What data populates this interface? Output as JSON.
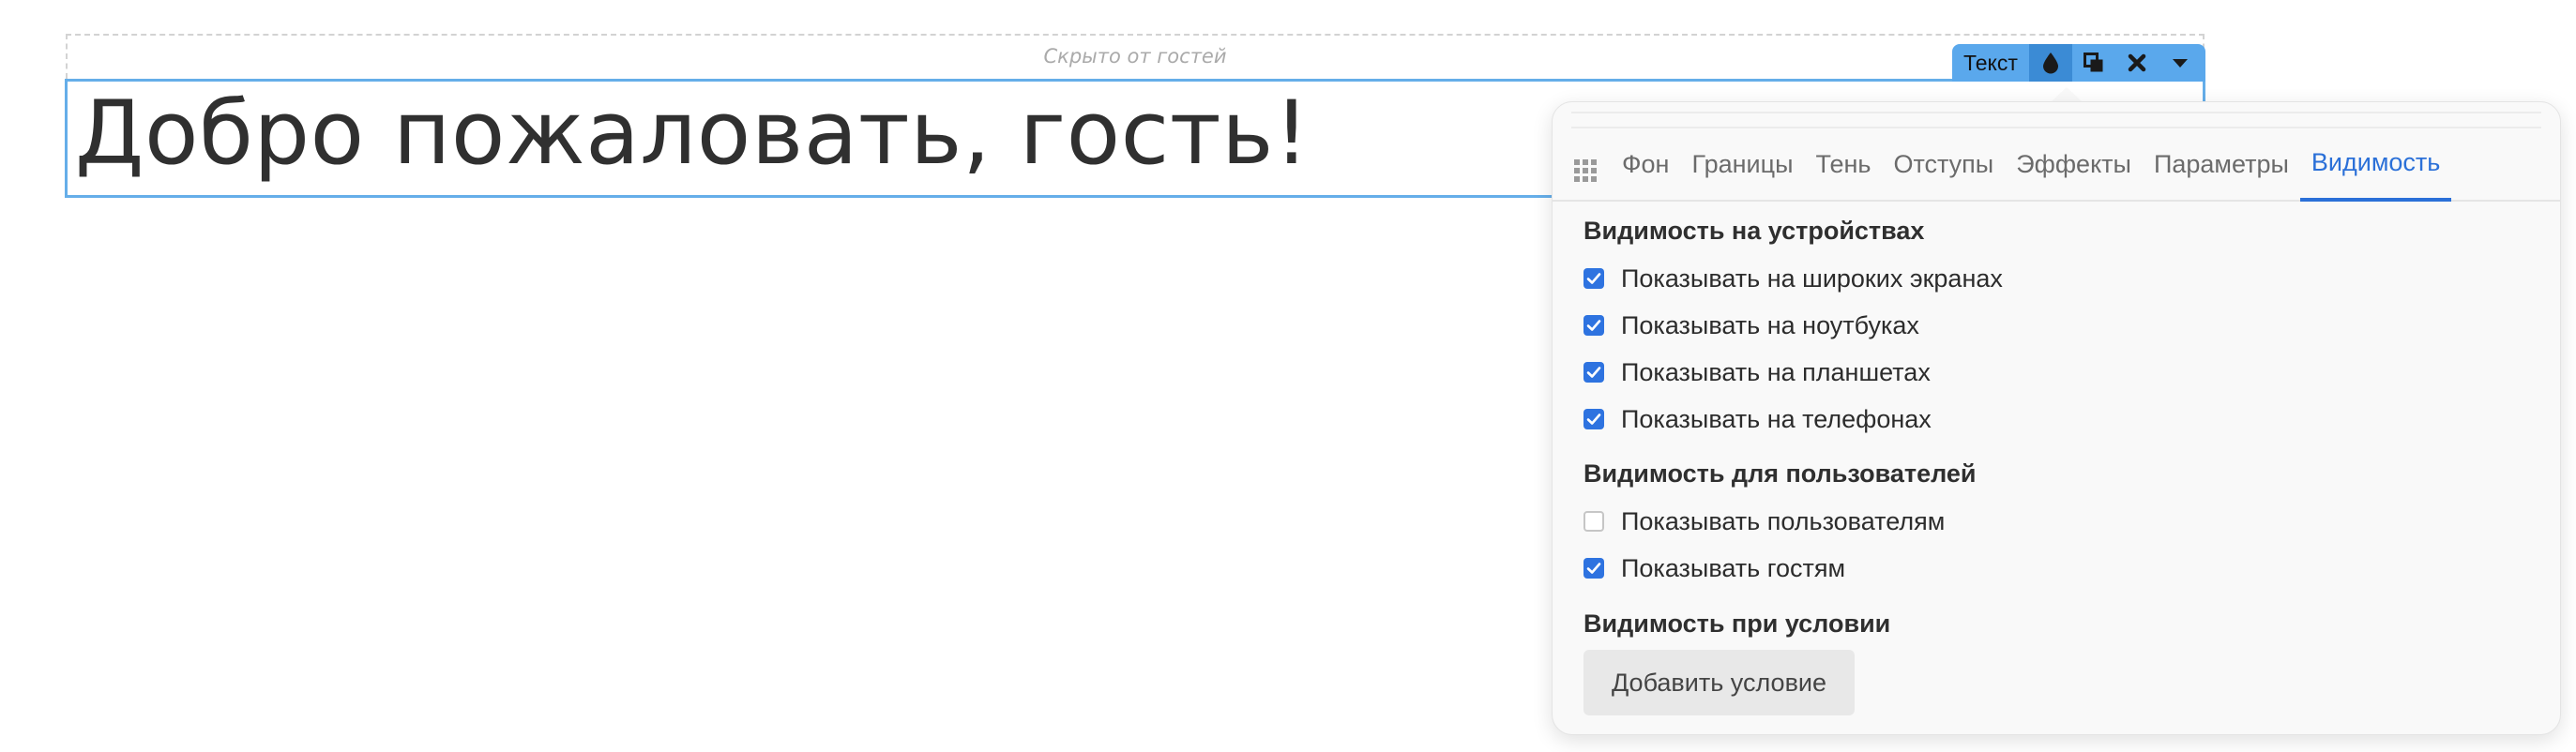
{
  "editor": {
    "hidden_note": "Скрыто от гостей",
    "greeting": "Добро пожаловать, гость!"
  },
  "toolbar": {
    "label": "Текст",
    "buttons": [
      "drop-icon",
      "duplicate-icon",
      "close-icon",
      "caret-down-icon"
    ]
  },
  "panel": {
    "tabs": [
      {
        "label": "Фон"
      },
      {
        "label": "Границы"
      },
      {
        "label": "Тень"
      },
      {
        "label": "Отступы"
      },
      {
        "label": "Эффекты"
      },
      {
        "label": "Параметры"
      },
      {
        "label": "Видимость",
        "active": true
      }
    ],
    "devices": {
      "title": "Видимость на устройствах",
      "options": [
        {
          "label": "Показывать на широких экранах",
          "checked": true
        },
        {
          "label": "Показывать на ноутбуках",
          "checked": true
        },
        {
          "label": "Показывать на планшетах",
          "checked": true
        },
        {
          "label": "Показывать на телефонах",
          "checked": true
        }
      ]
    },
    "users": {
      "title": "Видимость для пользователей",
      "options": [
        {
          "label": "Показывать пользователям",
          "checked": false
        },
        {
          "label": "Показывать гостям",
          "checked": true
        }
      ]
    },
    "condition": {
      "title": "Видимость при условии",
      "add_button": "Добавить условие"
    }
  },
  "colors": {
    "accent": "#2e73e0",
    "selection": "#5aa8ec",
    "text": "#303030"
  }
}
